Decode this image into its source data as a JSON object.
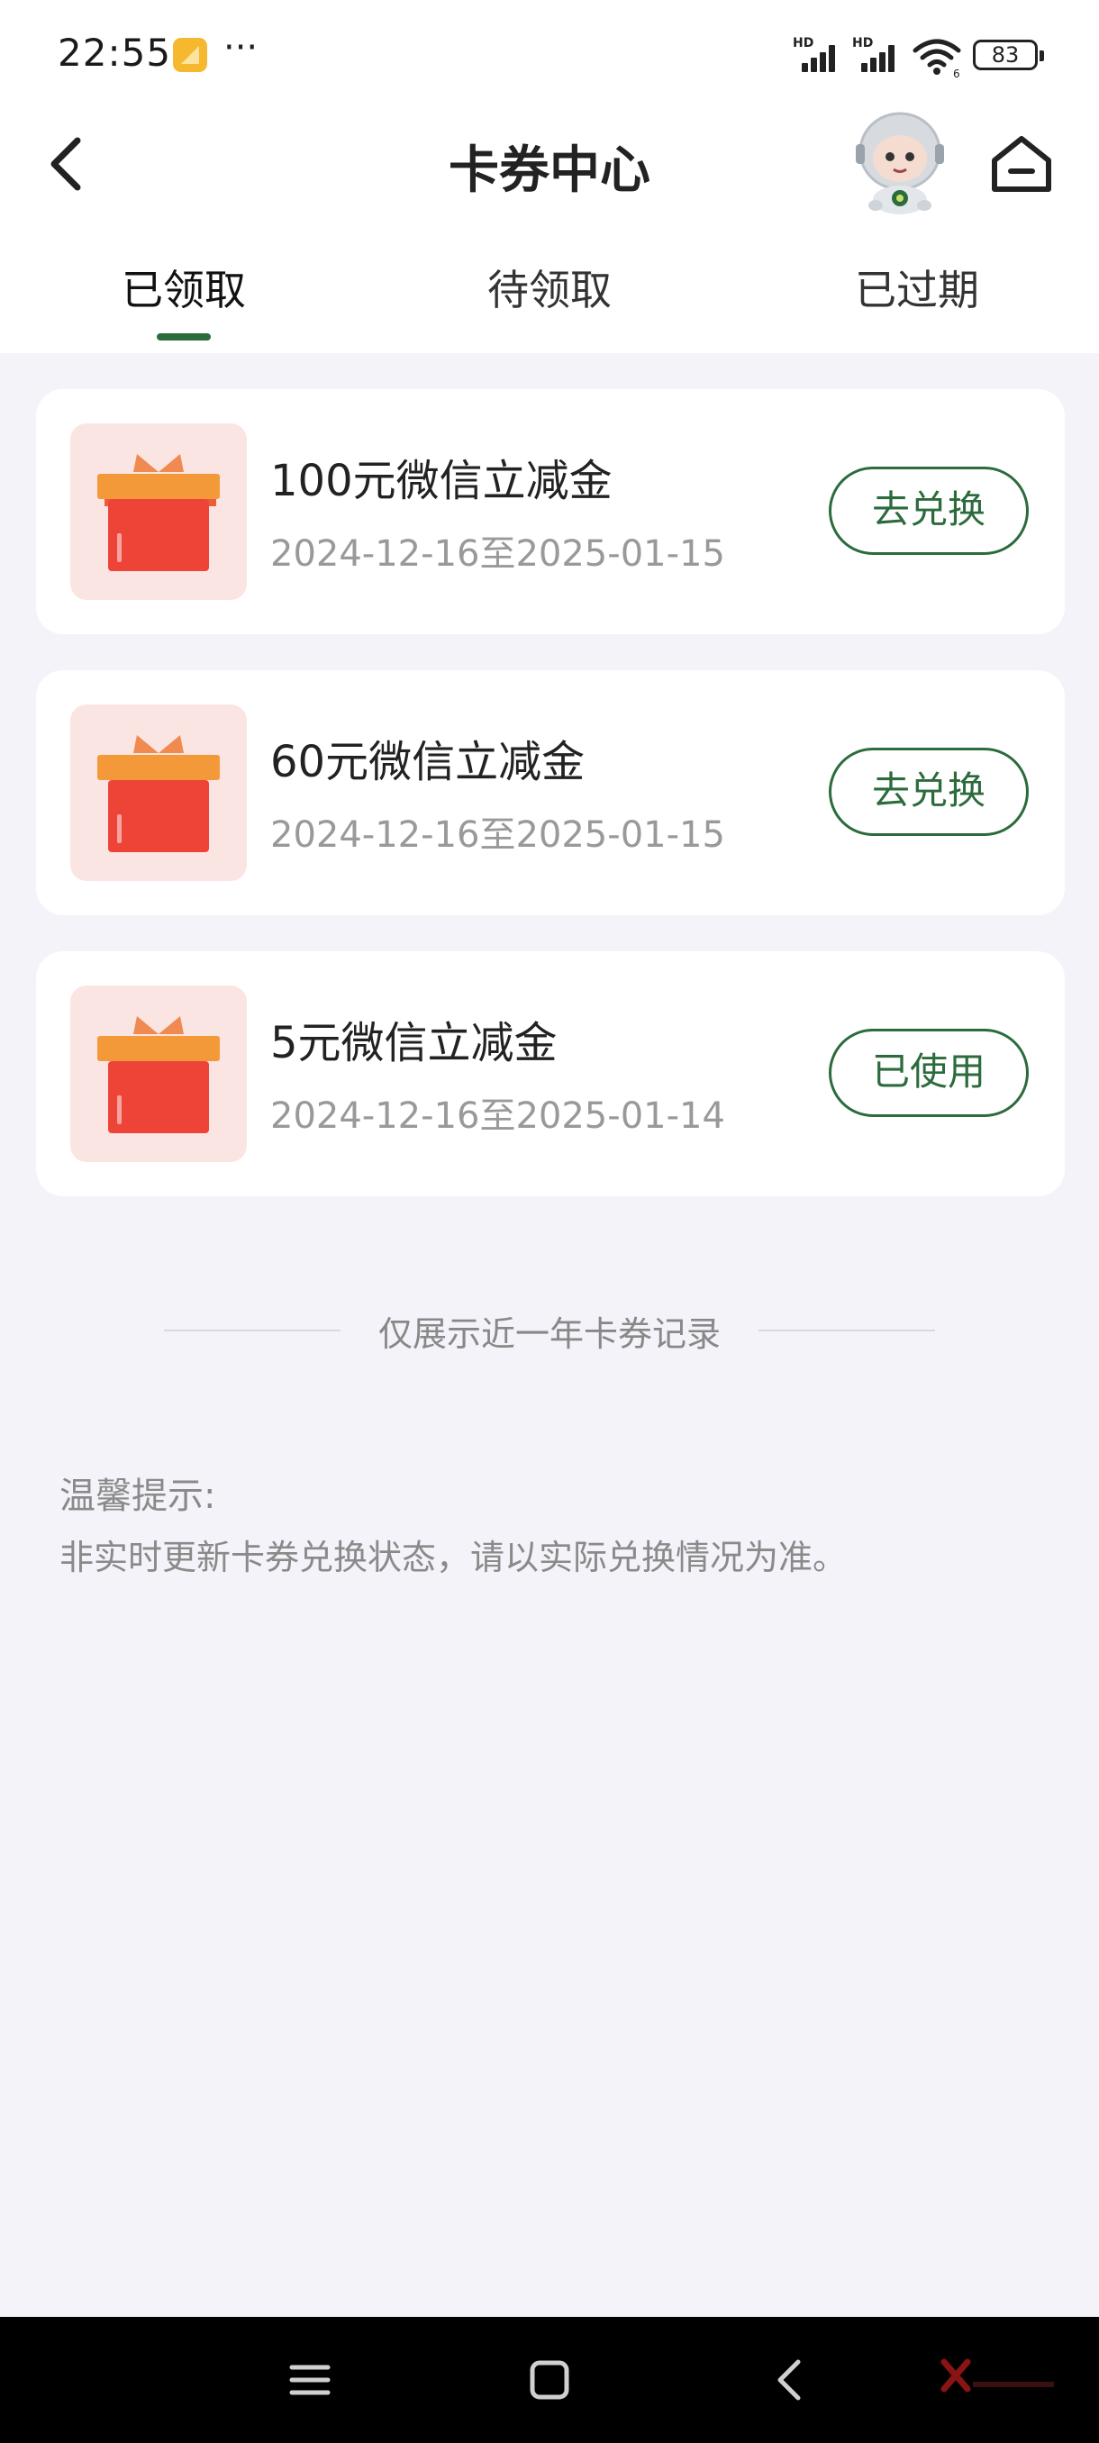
{
  "status_bar": {
    "time": "22:55",
    "more": "···",
    "signal_label_1": "HD",
    "signal_label_2": "HD",
    "wifi_label": "6",
    "battery": "83"
  },
  "header": {
    "title": "卡券中心"
  },
  "tabs": [
    {
      "label": "已领取",
      "active": true
    },
    {
      "label": "待领取",
      "active": false
    },
    {
      "label": "已过期",
      "active": false
    }
  ],
  "coupons": [
    {
      "title": "100元微信立减金",
      "date": "2024-12-16至2025-01-15",
      "action": "去兑换"
    },
    {
      "title": "60元微信立减金",
      "date": "2024-12-16至2025-01-15",
      "action": "去兑换"
    },
    {
      "title": "5元微信立减金",
      "date": "2024-12-16至2025-01-14",
      "action": "已使用"
    }
  ],
  "records_note": "仅展示近一年卡券记录",
  "tips": {
    "title": "温馨提示:",
    "body": "非实时更新卡券兑换状态，请以实际兑换情况为准。"
  },
  "colors": {
    "accent": "#2b6b3c",
    "background": "#f3f3f9",
    "gift_bg": "#fbe5e2",
    "gift_red": "#ee4438",
    "gift_orange": "#f4993a"
  },
  "icons": {
    "back": "chevron-left-icon",
    "home": "home-icon",
    "mascot": "astronaut-mascot-icon",
    "gift": "gift-box-icon"
  }
}
